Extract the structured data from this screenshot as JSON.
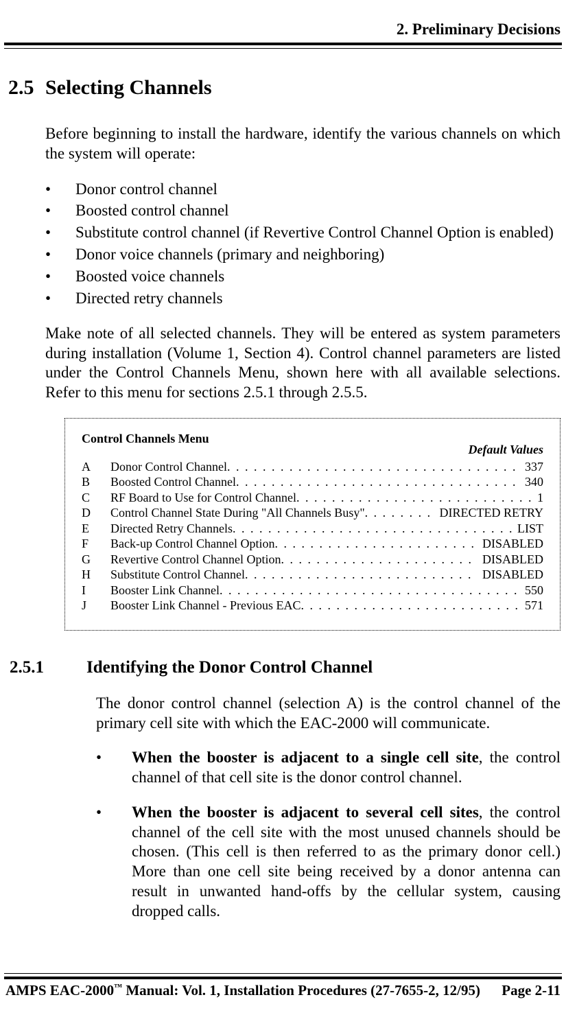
{
  "header": {
    "chapter": "2.  Preliminary Decisions"
  },
  "section": {
    "number": "2.5",
    "title": "Selecting Channels",
    "intro": "Before beginning to install the hardware, identify the various channels on which the system will operate:",
    "bullets": [
      "Donor control channel",
      "Boosted control channel",
      "Substitute control channel (if Revertive Control Channel Option is enabled)",
      "Donor voice channels (primary and neighboring)",
      "Boosted voice channels",
      "Directed retry channels"
    ],
    "note": "Make note of all selected channels.  They will be entered as system parameters during installation (Volume 1, Section 4).  Control channel parameters are listed under the Control Channels Menu, shown here with all available selections.  Refer to this menu for sections 2.5.1 through 2.5.5."
  },
  "menu": {
    "title": "Control Channels Menu",
    "default_label": "Default Values",
    "rows": [
      {
        "key": "A",
        "label": "Donor Control Channel",
        "value": "337"
      },
      {
        "key": "B",
        "label": "Boosted Control Channel",
        "value": "340"
      },
      {
        "key": "C",
        "label": "RF Board to Use for Control Channel",
        "value": "1"
      },
      {
        "key": "D",
        "label": "Control Channel State During \"All Channels Busy\"",
        "value": "DIRECTED RETRY"
      },
      {
        "key": "E",
        "label": "Directed Retry Channels",
        "value": "LIST"
      },
      {
        "key": "F",
        "label": "Back-up Control Channel Option",
        "value": "DISABLED"
      },
      {
        "key": "G",
        "label": "Revertive Control Channel Option",
        "value": "DISABLED"
      },
      {
        "key": "H",
        "label": "Substitute Control Channel",
        "value": "DISABLED"
      },
      {
        "key": "I",
        "label": "Booster Link Channel",
        "value": "550"
      },
      {
        "key": "J",
        "label": "Booster Link Channel - Previous EAC",
        "value": "571"
      }
    ]
  },
  "subsection": {
    "number": "2.5.1",
    "title": "Identifying the Donor Control Channel",
    "intro": "The donor control channel (selection A) is the control channel of the primary cell site with which the EAC-2000 will communicate.",
    "items": [
      {
        "lead": "When the booster is adjacent to a single cell site",
        "rest": ", the control channel of that cell site is the donor control channel."
      },
      {
        "lead": "When the booster is adjacent to several cell sites",
        "rest": ", the control channel of the cell site with the most unused channels should be chosen.  (This cell is then referred to as the primary donor cell.)  More than one cell site being received by a donor antenna can result in unwanted hand-offs by the cellular system, causing dropped calls."
      }
    ]
  },
  "footer": {
    "left_a": "AMPS EAC-2000",
    "left_b": " Manual:   Vol. 1, Installation Procedures (27-7655-2, 12/95)",
    "right": "Page 2-11"
  }
}
